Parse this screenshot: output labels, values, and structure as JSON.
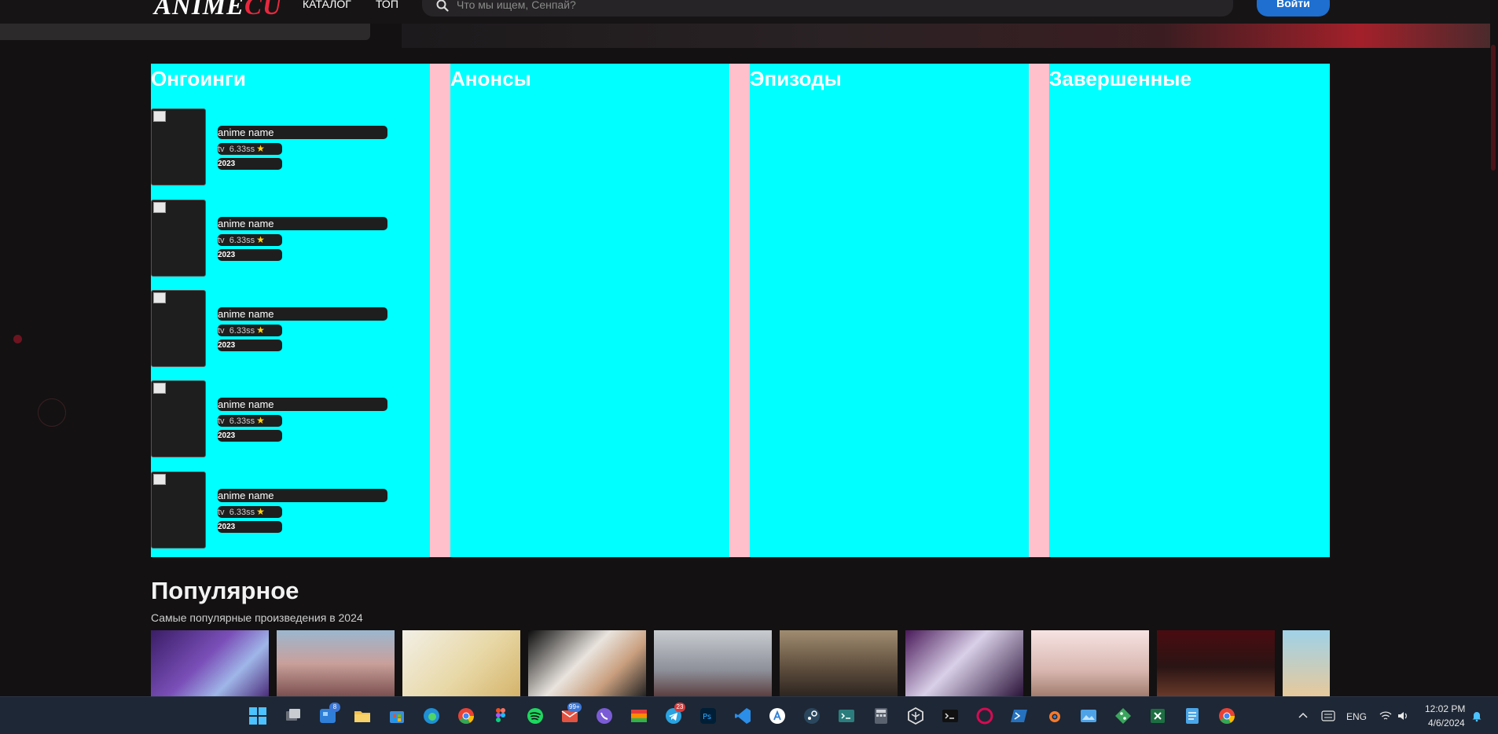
{
  "header": {
    "logo_prefix": "A",
    "logo_middle": "NIME",
    "logo_accent": "CU",
    "nav": [
      "КАТАЛОГ",
      "ТОП"
    ],
    "search_placeholder": "Что мы ищем, Сенпай?",
    "login_label": "Войти"
  },
  "columns": [
    {
      "title": "Онгоинги",
      "items": [
        {
          "name": "anime name",
          "type": "tv",
          "rating": "6.33ss",
          "year": "2023"
        },
        {
          "name": "anime name",
          "type": "tv",
          "rating": "6.33ss",
          "year": "2023"
        },
        {
          "name": "anime name",
          "type": "tv",
          "rating": "6.33ss",
          "year": "2023"
        },
        {
          "name": "anime name",
          "type": "tv",
          "rating": "6.33ss",
          "year": "2023"
        },
        {
          "name": "anime name",
          "type": "tv",
          "rating": "6.33ss",
          "year": "2023"
        }
      ]
    },
    {
      "title": "Анонсы",
      "items": []
    },
    {
      "title": "Эпизоды",
      "items": []
    },
    {
      "title": "Завершенные",
      "items": []
    }
  ],
  "popular": {
    "title": "Популярное",
    "subtitle": "Самые популярные произведения в 2024",
    "posters": [
      "poster-1",
      "poster-2",
      "poster-3",
      "poster-4",
      "poster-5",
      "poster-6",
      "poster-7",
      "poster-8",
      "poster-9",
      "poster-10"
    ]
  },
  "colors": {
    "column_bg": "#00ffff",
    "gutter_bg": "#ffc0cb",
    "page_bg": "#131112",
    "accent": "#e8283e",
    "login_bg": "#1e6fd0"
  },
  "taskbar": {
    "apps": [
      "windows-start-icon",
      "task-view-icon",
      "widgets-icon",
      "file-explorer-icon",
      "microsoft-store-icon",
      "edge-icon",
      "chrome-icon",
      "figma-icon",
      "spotify-icon",
      "mail-icon",
      "viber-icon",
      "color-app-icon",
      "telegram-icon",
      "photoshop-icon",
      "vscode-icon",
      "app-store-icon",
      "steam-icon",
      "terminal-icon",
      "calculator-icon",
      "unity-icon",
      "console-icon",
      "debian-icon",
      "powershell-icon",
      "blender-icon",
      "photos-icon",
      "git-icon",
      "excel-like-icon",
      "notepad-icon",
      "chrome-icon"
    ],
    "badges": {
      "widgets": "8",
      "mail": "99+",
      "telegram": "23"
    },
    "language": "ENG",
    "time": "12:02 PM",
    "date": "4/6/2024"
  }
}
